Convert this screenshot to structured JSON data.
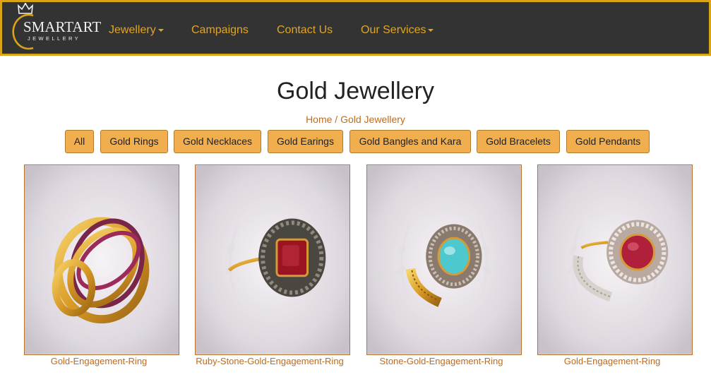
{
  "brand": {
    "name": "SMARTART",
    "sub": "JEWELLERY"
  },
  "nav": [
    {
      "label": "Jewellery",
      "dropdown": true
    },
    {
      "label": "Campaigns",
      "dropdown": false
    },
    {
      "label": "Contact Us",
      "dropdown": false
    },
    {
      "label": "Our Services",
      "dropdown": true
    }
  ],
  "page_title": "Gold Jewellery",
  "breadcrumb": {
    "home": "Home",
    "separator": " / ",
    "current": "Gold Jewellery"
  },
  "filters": [
    "All",
    "Gold Rings",
    "Gold Necklaces",
    "Gold Earings",
    "Gold Bangles and Kara",
    "Gold Bracelets",
    "Gold Pendants"
  ],
  "products": [
    {
      "name": "Gold-Engagement-Ring",
      "stone_color": "#9c2b5a"
    },
    {
      "name": "Ruby-Stone-Gold-Engagement-Ring",
      "stone_color": "#9a1422"
    },
    {
      "name": "Stone-Gold-Engagement-Ring",
      "stone_color": "#4ec8cf"
    },
    {
      "name": "Gold-Engagement-Ring",
      "stone_color": "#b0203a"
    }
  ],
  "colors": {
    "accent": "#e0a526",
    "header_bg": "#333333",
    "button_bg": "#f0ae4e",
    "link": "#c26a15"
  }
}
